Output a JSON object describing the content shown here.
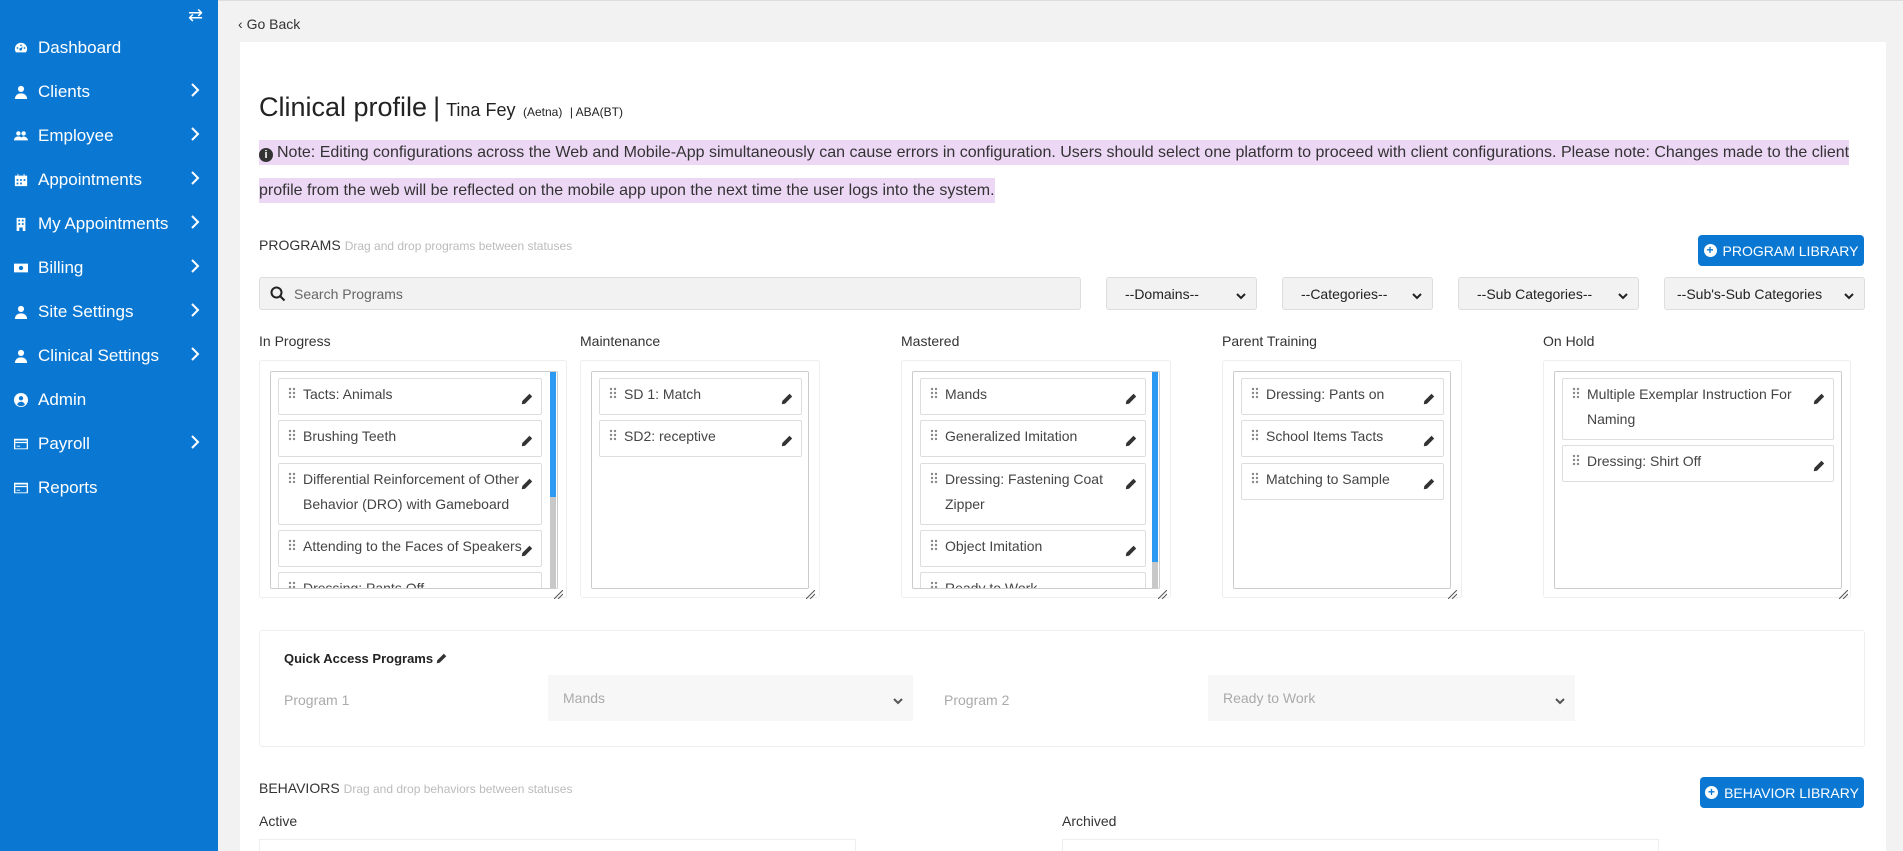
{
  "sidebar": {
    "items": [
      {
        "label": "Dashboard",
        "icon": "dashboard-icon",
        "has_submenu": false
      },
      {
        "label": "Clients",
        "icon": "user-icon",
        "has_submenu": true
      },
      {
        "label": "Employee",
        "icon": "users-icon",
        "has_submenu": true
      },
      {
        "label": "Appointments",
        "icon": "calendar-icon",
        "has_submenu": true
      },
      {
        "label": "My Appointments",
        "icon": "building-icon",
        "has_submenu": true
      },
      {
        "label": "Billing",
        "icon": "money-icon",
        "has_submenu": true
      },
      {
        "label": "Site Settings",
        "icon": "user-icon",
        "has_submenu": true
      },
      {
        "label": "Clinical Settings",
        "icon": "user-icon",
        "has_submenu": true
      },
      {
        "label": "Admin",
        "icon": "user-circle-icon",
        "has_submenu": false
      },
      {
        "label": "Payroll",
        "icon": "credit-card-icon",
        "has_submenu": true
      },
      {
        "label": "Reports",
        "icon": "credit-card-icon",
        "has_submenu": false
      }
    ]
  },
  "topbar": {
    "go_back": "Go Back"
  },
  "header": {
    "title": "Clinical profile",
    "separator": "|",
    "client_name": "Tina Fey",
    "insurance": "(Aetna)",
    "service": "| ABA(BT)"
  },
  "note": {
    "text": "Note: Editing configurations across the Web and Mobile-App simultaneously can cause errors in configuration. Users should select one platform to proceed with client configurations. Please note: Changes made to the client profile from the web will be reflected on the mobile app upon the next time the user logs into the system."
  },
  "programs": {
    "heading": "PROGRAMS",
    "hint": "Drag and drop programs between statuses",
    "library_button": "PROGRAM LIBRARY",
    "search_placeholder": "Search Programs",
    "filters": [
      "--Domains--",
      "--Categories--",
      "--Sub Categories--",
      "--Sub's-Sub Categories"
    ],
    "columns": [
      {
        "label": "In Progress",
        "items": [
          "Tacts: Animals",
          "Brushing Teeth",
          "Differential Reinforcement of Other Behavior (DRO) with Gameboard",
          "Attending to the Faces of Speakers",
          "Dressing: Pants Off"
        ]
      },
      {
        "label": "Maintenance",
        "items": [
          "SD 1: Match",
          "SD2: receptive"
        ]
      },
      {
        "label": "Mastered",
        "items": [
          "Mands",
          "Generalized Imitation",
          "Dressing: Fastening Coat Zipper",
          "Object Imitation",
          "Ready to Work"
        ]
      },
      {
        "label": "Parent Training",
        "items": [
          "Dressing: Pants on",
          "School Items Tacts",
          "Matching to Sample"
        ]
      },
      {
        "label": "On Hold",
        "items": [
          "Multiple Exemplar Instruction For Naming",
          "Dressing: Shirt Off"
        ]
      }
    ]
  },
  "quick_access": {
    "title": "Quick Access Programs",
    "program1_label": "Program 1",
    "program1_value": "Mands",
    "program2_label": "Program 2",
    "program2_value": "Ready to Work"
  },
  "behaviors": {
    "heading": "BEHAVIORS",
    "hint": "Drag and drop behaviors between statuses",
    "library_button": "BEHAVIOR LIBRARY",
    "columns": [
      "Active",
      "Archived"
    ]
  },
  "colors": {
    "brand": "#0a78d2",
    "note_highlight": "#ecd7f5",
    "scroll_thumb": "#2c9af2"
  }
}
